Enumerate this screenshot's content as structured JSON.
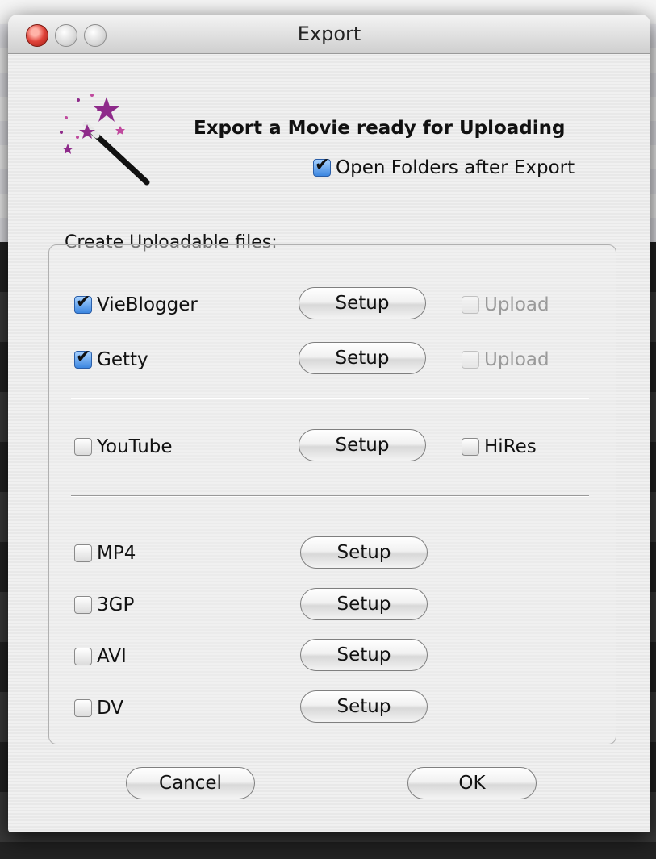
{
  "window": {
    "title": "Export"
  },
  "header": {
    "headline": "Export a Movie ready for Uploading",
    "open_folders": {
      "label": "Open Folders after Export",
      "checked": true
    }
  },
  "section_label": "Create Uploadable files:",
  "rows": [
    {
      "label": "VieBlogger",
      "checked": true,
      "setup_label": "Setup",
      "extra": {
        "label": "Upload",
        "enabled": false
      }
    },
    {
      "label": "Getty",
      "checked": true,
      "setup_label": "Setup",
      "extra": {
        "label": "Upload",
        "enabled": false
      }
    },
    {
      "label": "YouTube",
      "checked": false,
      "setup_label": "Setup",
      "extra": {
        "label": "HiRes",
        "enabled": true
      }
    },
    {
      "label": "MP4",
      "checked": false,
      "setup_label": "Setup"
    },
    {
      "label": "3GP",
      "checked": false,
      "setup_label": "Setup"
    },
    {
      "label": "AVI",
      "checked": false,
      "setup_label": "Setup"
    },
    {
      "label": "DV",
      "checked": false,
      "setup_label": "Setup"
    }
  ],
  "buttons": {
    "cancel": "Cancel",
    "ok": "OK"
  },
  "icons": {
    "wand": "magic-wand-icon",
    "close": "close-icon",
    "minimize": "minimize-icon",
    "zoom": "zoom-icon"
  },
  "colors": {
    "checkbox_accent": "#3c86e0",
    "star": "#8e2a8a",
    "close": "#e0433a"
  }
}
